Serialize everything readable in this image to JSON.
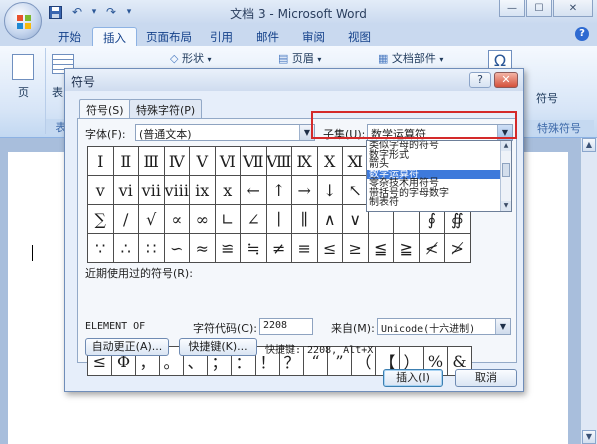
{
  "window": {
    "title": "文档 3 - Microsoft Word",
    "minimize": "—",
    "maximize": "☐",
    "close": "✕"
  },
  "qat": {
    "save_icon": "save-icon",
    "undo": "↶",
    "undo_drop": "▾",
    "redo": "↷",
    "more": "▾"
  },
  "ribbon": {
    "tabs": [
      "开始",
      "插入",
      "页面布局",
      "引用",
      "邮件",
      "审阅",
      "视图"
    ],
    "active_tab": "插入",
    "items": {
      "shapes": "形状",
      "header": "页眉",
      "doc_parts": "文档部件",
      "page": "页",
      "table_partial": "表",
      "symbol": "符号",
      "special_symbols": "特殊符号",
      "table_group_partial": "表"
    }
  },
  "dialog": {
    "title": "符号",
    "help": "?",
    "close": "✕",
    "tabs": [
      "符号(S)",
      "特殊字符(P)"
    ],
    "font_label": "字体(F):",
    "font_value": "(普通文本)",
    "subset_label": "子集(U):",
    "subset_value": "数学运算符",
    "subset_options": [
      "类似字母的符号",
      "数字形式",
      "箭头",
      "数学运算符",
      "零杂技术用符号",
      "带括号的字母数字",
      "制表符"
    ],
    "subset_selected_index": 3,
    "symbols": [
      [
        "Ⅰ",
        "Ⅱ",
        "Ⅲ",
        "Ⅳ",
        "Ⅴ",
        "Ⅵ",
        "Ⅶ",
        "Ⅷ",
        "Ⅸ",
        "Ⅹ",
        "Ⅺ",
        "",
        "",
        "",
        ""
      ],
      [
        "ⅴ",
        "ⅵ",
        "ⅶ",
        "ⅷ",
        "ⅸ",
        "ⅹ",
        "←",
        "↑",
        "→",
        "↓",
        "↖",
        "",
        "",
        "",
        ""
      ],
      [
        "∑",
        "∕",
        "√",
        "∝",
        "∞",
        "∟",
        "∠",
        "∣",
        "∥",
        "∧",
        "∨",
        "",
        "",
        "∮",
        "∯"
      ],
      [
        "∵",
        "∴",
        "∷",
        "∽",
        "≈",
        "≌",
        "≒",
        "≠",
        "≡",
        "≤",
        "≥",
        "≦",
        "≧",
        "≮",
        "≯"
      ]
    ],
    "recent_label": "近期使用过的符号(R):",
    "recent_symbols": [
      "≤",
      "Φ",
      "，",
      "。",
      "、",
      "；",
      "：",
      "！",
      "？",
      "“",
      "”",
      "（",
      "【",
      "）",
      "%",
      "&"
    ],
    "char_name": "ELEMENT OF",
    "char_code_label": "字符代码(C):",
    "char_code_value": "2208",
    "from_label": "来自(M):",
    "from_value": "Unicode(十六进制)",
    "autocorrect_button": "自动更正(A)...",
    "shortcut_button": "快捷键(K)...",
    "shortcut_text": "快捷键: 2208, Alt+X",
    "insert_button": "插入(I)",
    "cancel_button": "取消"
  },
  "colors": {
    "highlight": "#d42a2a",
    "selection": "#3e7adb"
  }
}
